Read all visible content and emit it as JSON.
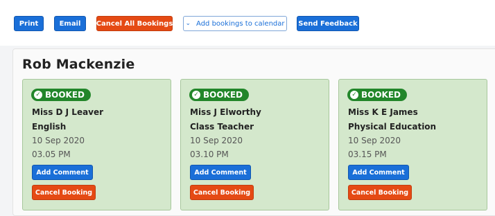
{
  "toolbar": {
    "print": "Print",
    "email": "Email",
    "cancel_all": "Cancel All Bookings",
    "add_calendar": "Add bookings to calendar",
    "send_feedback": "Send Feedback"
  },
  "colors": {
    "primary": "#1a6fd8",
    "danger": "#e54a14",
    "booked": "#22862a",
    "card": "#d4e8cc"
  },
  "parent_name": "Rob Mackenzie",
  "bookings": [
    {
      "status": "BOOKED",
      "teacher": "Miss D J Leaver",
      "subject": "English",
      "date": "10 Sep 2020",
      "time": "03.05 PM",
      "add_comment": "Add Comment",
      "cancel": "Cancel Booking"
    },
    {
      "status": "BOOKED",
      "teacher": "Miss J Elworthy",
      "subject": "Class Teacher",
      "date": "10 Sep 2020",
      "time": "03.10 PM",
      "add_comment": "Add Comment",
      "cancel": "Cancel Booking"
    },
    {
      "status": "BOOKED",
      "teacher": "Miss K E James",
      "subject": "Physical Education",
      "date": "10 Sep 2020",
      "time": "03.15 PM",
      "add_comment": "Add Comment",
      "cancel": "Cancel Booking"
    }
  ]
}
